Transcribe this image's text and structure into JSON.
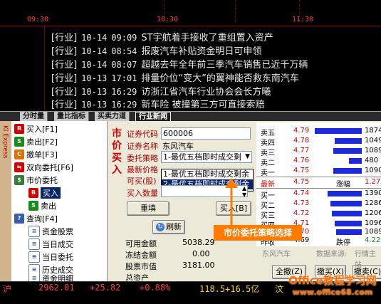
{
  "chart_axis": {
    "times": [
      "09:30",
      "10:30",
      "11:30"
    ]
  },
  "news": [
    {
      "tag": "[行业]",
      "date": "10-14",
      "time": "09:09",
      "title": "ST宇航着手接收了重组置入资产"
    },
    {
      "tag": "[行业]",
      "date": "10-14",
      "time": "08:54",
      "title": "报废汽车补贴资金明日可申领"
    },
    {
      "tag": "[行业]",
      "date": "10-14",
      "time": "08:07",
      "title": "超越去年全年前三季汽车销售已近千万辆"
    },
    {
      "tag": "[行业]",
      "date": "10-13",
      "time": "17:01",
      "title": "排量价位“变大”的翼神能否救东南汽车"
    },
    {
      "tag": "[行业]",
      "date": "10-13",
      "time": "16:29",
      "title": "访浙江省汽车行业协会会长方曦"
    },
    {
      "tag": "[行业]",
      "date": "10-13",
      "time": "16:29",
      "title": "新车险 被撞第三方可直接索赔"
    }
  ],
  "tabs": [
    "分时量",
    "量比指标",
    "买卖力道",
    "行业新闻"
  ],
  "sidebar": {
    "strip_text": "Kl Express",
    "items": [
      {
        "label": "买入[F1]"
      },
      {
        "label": "卖出[F2]"
      },
      {
        "label": "撤单[F3]"
      },
      {
        "label": "双向委托[F6]"
      },
      {
        "label": "市价委托"
      },
      {
        "label": "买入"
      },
      {
        "label": "卖出"
      },
      {
        "label": "查询[F4]"
      },
      {
        "label": "资金股票"
      },
      {
        "label": "当日成交"
      },
      {
        "label": "当日委托"
      },
      {
        "label": "历史成交"
      },
      {
        "label": "资金明细"
      }
    ]
  },
  "form": {
    "vertical_title": "市价买入",
    "code_label": "证券代码",
    "code_value": "600006",
    "name_label": "证券名称",
    "name_value": "东风汽车",
    "strategy_label": "委托策略",
    "strategy_value": "1-最优五档即时成交剩",
    "strategy_options": [
      "1-最优五档即时成交剩余",
      "2-最优五档即时成交剩余"
    ],
    "price_label": "最新价格",
    "avail_label": "可买(股)",
    "qty_label": "买入数量",
    "refill_btn": "重填",
    "buy_btn": "买入[B]",
    "refresh_btn": "刷新",
    "funds": [
      {
        "label": "可用金额",
        "value": "5038.29"
      },
      {
        "label": "冻结金额",
        "value": "0.00"
      },
      {
        "label": "股票市值",
        "value": "3181.00"
      },
      {
        "label": "总资产",
        "value": ""
      }
    ],
    "all_cancel_btn": "全撤(Z)",
    "cancel_buy_btn": "撤买(X)",
    "cancel_sell_btn": "撤卖(C)"
  },
  "quotes": {
    "asks": [
      {
        "label": "卖五",
        "price": "4.79",
        "vol": "1874"
      },
      {
        "label": "卖四",
        "price": "4.78",
        "vol": "1049"
      },
      {
        "label": "卖三",
        "price": "4.77",
        "vol": "1089"
      },
      {
        "label": "卖二",
        "price": "4.76",
        "vol": "480"
      },
      {
        "label": "卖一",
        "price": "4.75",
        "vol": "1090"
      }
    ],
    "latest_label": "最新",
    "latest_price": "4.75",
    "change_label": "涨幅",
    "change_value": "1.27",
    "bids": [
      {
        "label": "买一",
        "price": "4.74",
        "vol": "1390"
      },
      {
        "label": "买二",
        "price": "4.73",
        "vol": "1286"
      },
      {
        "label": "买三",
        "price": "4.72",
        "vol": "1206"
      },
      {
        "label": "买四",
        "price": "4.71",
        "vol": "1096"
      },
      {
        "label": "买五",
        "price": "4.70",
        "vol": "1089"
      }
    ],
    "close_label": "昨收",
    "close_price": "4.69",
    "fall_label": "跌停",
    "fall_price": "4.22",
    "footer_name": "东风汽车",
    "footer_src": "数据来源:",
    "footer_src2": "行情主站"
  },
  "callout": "市价委托策略选择",
  "ticker": {
    "market": "沪",
    "index": "2962.01",
    "change": "+25.82",
    "pct": "+0.88%",
    "volume": "118.5+16.5亿",
    "extra": "汶"
  },
  "watermark": {
    "line1": "Office教程学习网",
    "line2": "www.office68.com"
  },
  "colors": {
    "accent_red": "#d40000",
    "bid_bar": "#1d2bd6",
    "callout": "#ff7a00",
    "ticker_yellow": "#ffd400",
    "ticker_red": "#ff3b3b"
  }
}
